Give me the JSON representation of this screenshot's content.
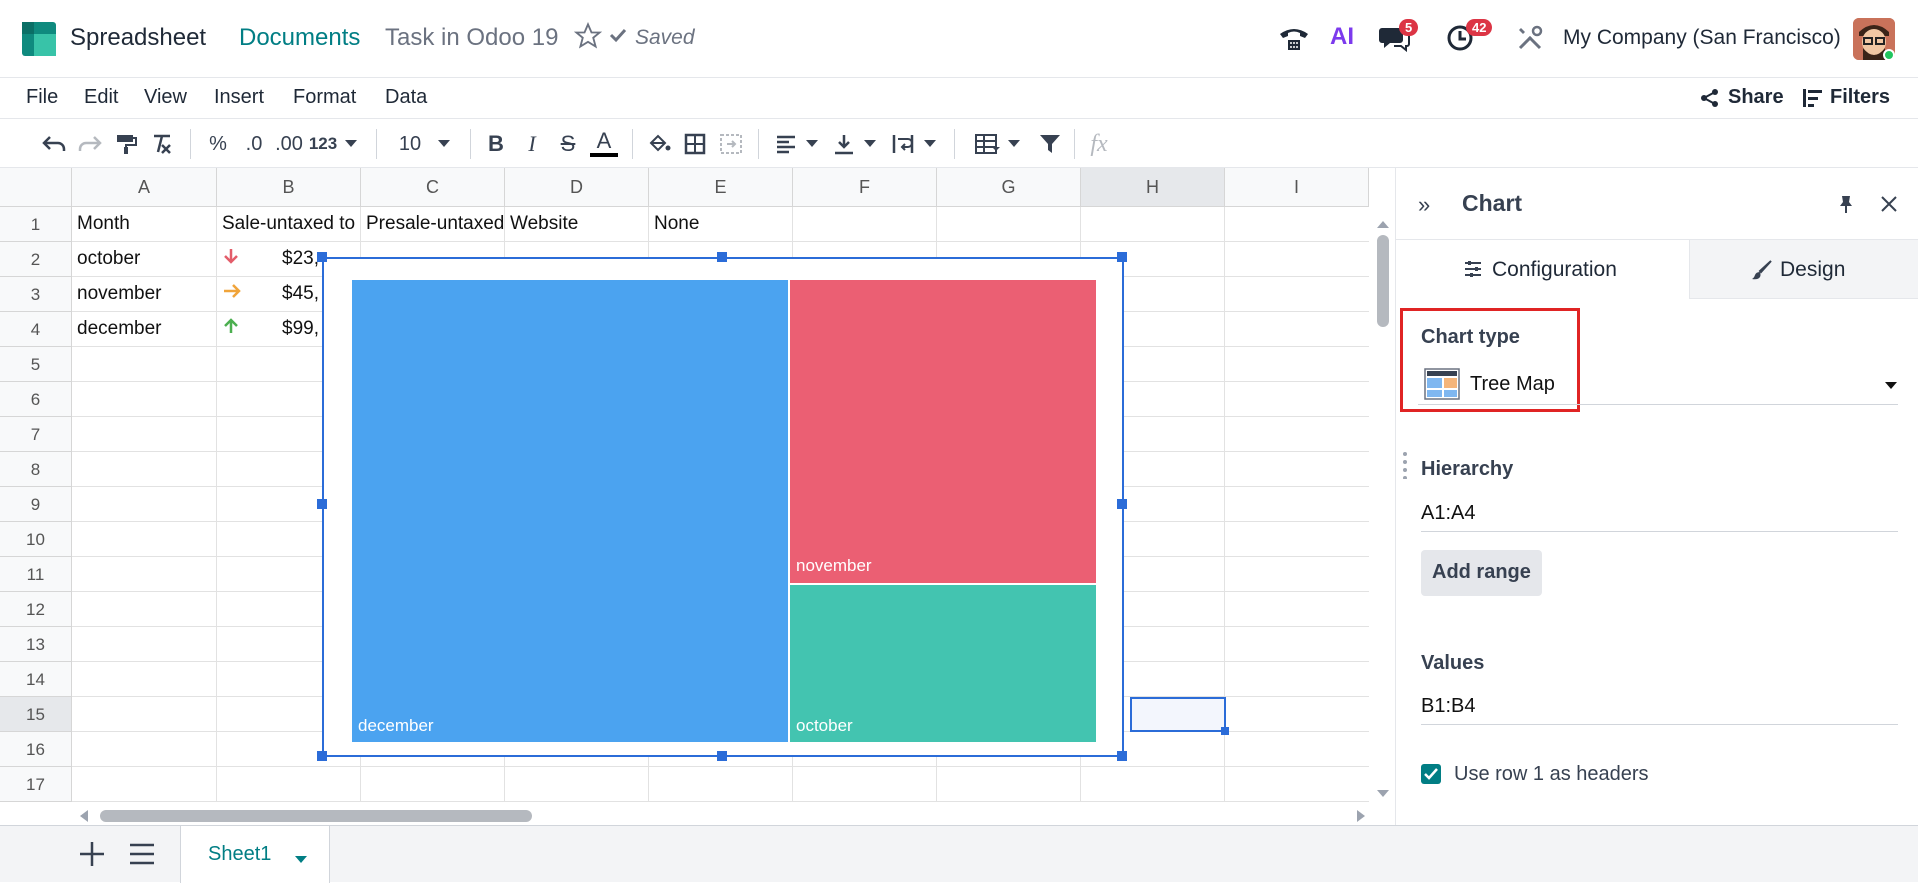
{
  "topbar": {
    "app_name": "Spreadsheet",
    "breadcrumb_parent": "Documents",
    "document_name": "Task in Odoo 19",
    "saved_status": "Saved",
    "ai_label": "AI",
    "messages_badge": "5",
    "activities_badge": "42",
    "company": "My Company (San Francisco)"
  },
  "menubar": {
    "items": [
      "File",
      "Edit",
      "View",
      "Insert",
      "Format",
      "Data"
    ],
    "share_label": "Share",
    "filters_label": "Filters"
  },
  "toolbar": {
    "percent": "%",
    "dec_decrease": ".0",
    "dec_increase": ".00",
    "format_more": "123",
    "font_size": "10",
    "bold": "B",
    "italic": "I",
    "strike": "S",
    "text_color": "A",
    "fx": "fx"
  },
  "grid": {
    "columns": [
      "A",
      "B",
      "C",
      "D",
      "E",
      "F",
      "G",
      "H",
      "I"
    ],
    "rows": [
      "1",
      "2",
      "3",
      "4",
      "5",
      "6",
      "7",
      "8",
      "9",
      "10",
      "11",
      "12",
      "13",
      "14",
      "15",
      "16",
      "17"
    ],
    "header_cells": [
      "Month",
      "Sale-untaxed to",
      "Presale-untaxed",
      "Website",
      "None"
    ],
    "data_rows": [
      {
        "month": "october",
        "trend": "down",
        "value": "$23,"
      },
      {
        "month": "november",
        "trend": "right",
        "value": "$45,"
      },
      {
        "month": "december",
        "trend": "up",
        "value": "$99,"
      }
    ]
  },
  "chart": {
    "chart_data": {
      "type": "treemap",
      "labels": [
        "december",
        "november",
        "october"
      ],
      "colors": [
        "#4ba3f0",
        "#eb5f73",
        "#43c4b0"
      ]
    }
  },
  "panel": {
    "title": "Chart",
    "tab_configuration": "Configuration",
    "tab_design": "Design",
    "chart_type_label": "Chart type",
    "chart_type_value": "Tree Map",
    "hierarchy_label": "Hierarchy",
    "hierarchy_value": "A1:A4",
    "add_range_label": "Add range",
    "values_label": "Values",
    "values_value": "B1:B4",
    "use_headers_label": "Use row 1 as headers"
  },
  "bottombar": {
    "sheet_name": "Sheet1"
  }
}
